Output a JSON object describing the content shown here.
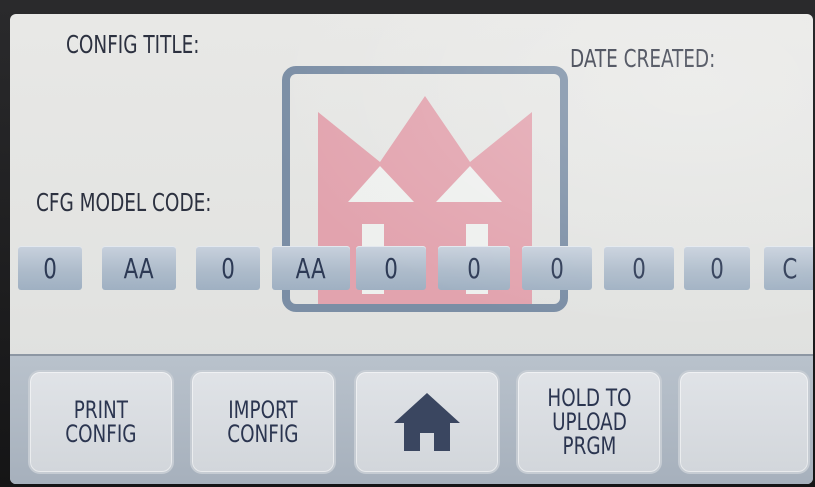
{
  "header": {
    "config_title_label": "CONFIG TITLE:",
    "date_created_label": "DATE CREATED:"
  },
  "model": {
    "label": "CFG MODEL CODE:",
    "codes": [
      "0",
      "AA",
      "0",
      "AA",
      "0",
      "0",
      "0",
      "0",
      "0",
      "C"
    ]
  },
  "logo": {
    "name": "crown-logo-icon",
    "crown_color": "#e2a3ae",
    "frame_color": "#7b8ea5"
  },
  "toolbar": {
    "print_config": "PRINT\nCONFIG",
    "import_config": "IMPORT\nCONFIG",
    "home_icon": "home-icon",
    "hold_to_upload": "HOLD TO\nUPLOAD\nPRGM",
    "blank": ""
  },
  "colors": {
    "screen_bg": "#e4e5e3",
    "code_cell": "#aebccb",
    "toolbar_bg": "#b0bac5",
    "text": "#2c3140"
  }
}
